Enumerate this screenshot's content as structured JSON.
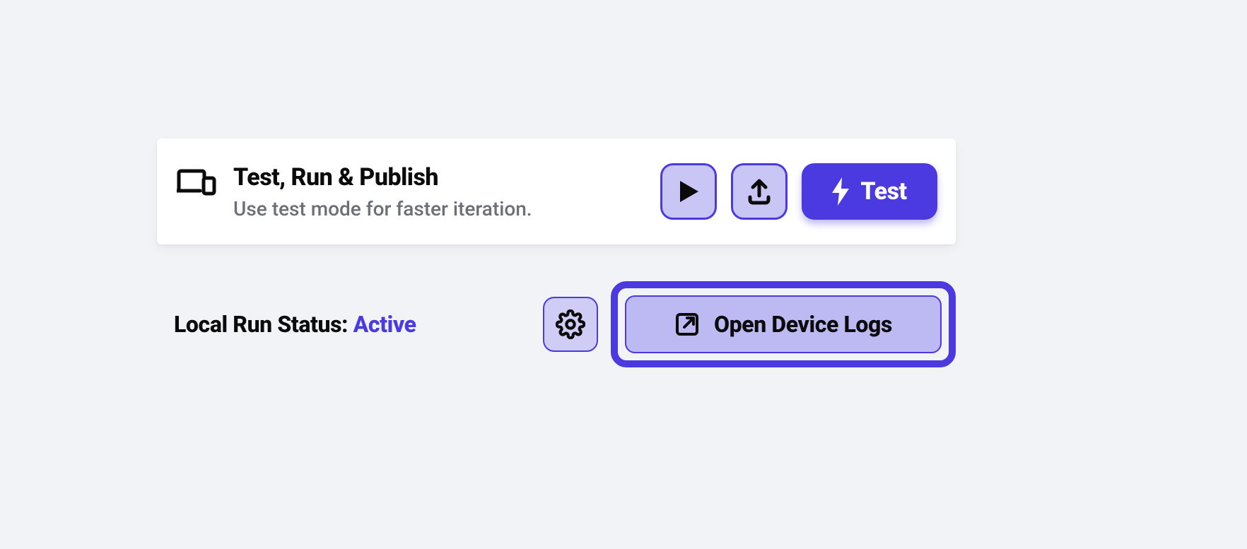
{
  "card": {
    "title": "Test, Run & Publish",
    "subtitle": "Use test mode for faster iteration.",
    "test_button_label": "Test"
  },
  "status": {
    "label": "Local Run Status: ",
    "value": "Active",
    "logs_button_label": "Open Device Logs"
  }
}
